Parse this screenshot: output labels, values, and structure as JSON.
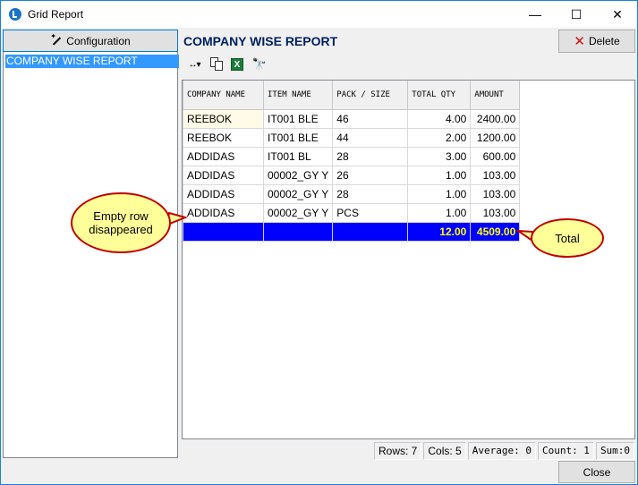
{
  "window": {
    "title": "Grid Report",
    "controls": {
      "minimize": "—",
      "maximize": "☐",
      "close": "✕"
    }
  },
  "sidebar": {
    "config_button_label": "Configuration",
    "reports": [
      {
        "label": "COMPANY WISE REPORT",
        "selected": true
      }
    ]
  },
  "report": {
    "title": "COMPANY WISE REPORT",
    "delete_label": "Delete",
    "toolbar": {
      "resize_glyph": "↔▾",
      "excel_glyph": "X",
      "find_glyph": "🔭"
    }
  },
  "grid": {
    "columns": [
      "COMPANY NAME",
      "ITEM NAME",
      "PACK / SIZE",
      "TOTAL QTY",
      "AMOUNT"
    ],
    "rows": [
      [
        "REEBOK",
        "IT001 BLE",
        "46",
        "4.00",
        "2400.00"
      ],
      [
        "REEBOK",
        "IT001 BLE",
        "44",
        "2.00",
        "1200.00"
      ],
      [
        "ADDIDAS",
        "IT001 BL",
        "28",
        "3.00",
        "600.00"
      ],
      [
        "ADDIDAS",
        "00002_GY Y",
        "26",
        "1.00",
        "103.00"
      ],
      [
        "ADDIDAS",
        "00002_GY Y",
        "28",
        "1.00",
        "103.00"
      ],
      [
        "ADDIDAS",
        "00002_GY Y",
        "PCS",
        "1.00",
        "103.00"
      ]
    ],
    "total_row": [
      "",
      "",
      "",
      "12.00",
      "4509.00"
    ],
    "colors": {
      "total_bg": "#0000ff",
      "total_text": "#ffff00"
    }
  },
  "annotations": {
    "empty_row": "Empty row disappeared",
    "total": "Total"
  },
  "status": {
    "rows": "Rows: 7",
    "cols": "Cols: 5",
    "average": "Average: 0",
    "count": "Count: 1",
    "sum": "Sum:0"
  },
  "footer": {
    "close_label": "Close"
  }
}
